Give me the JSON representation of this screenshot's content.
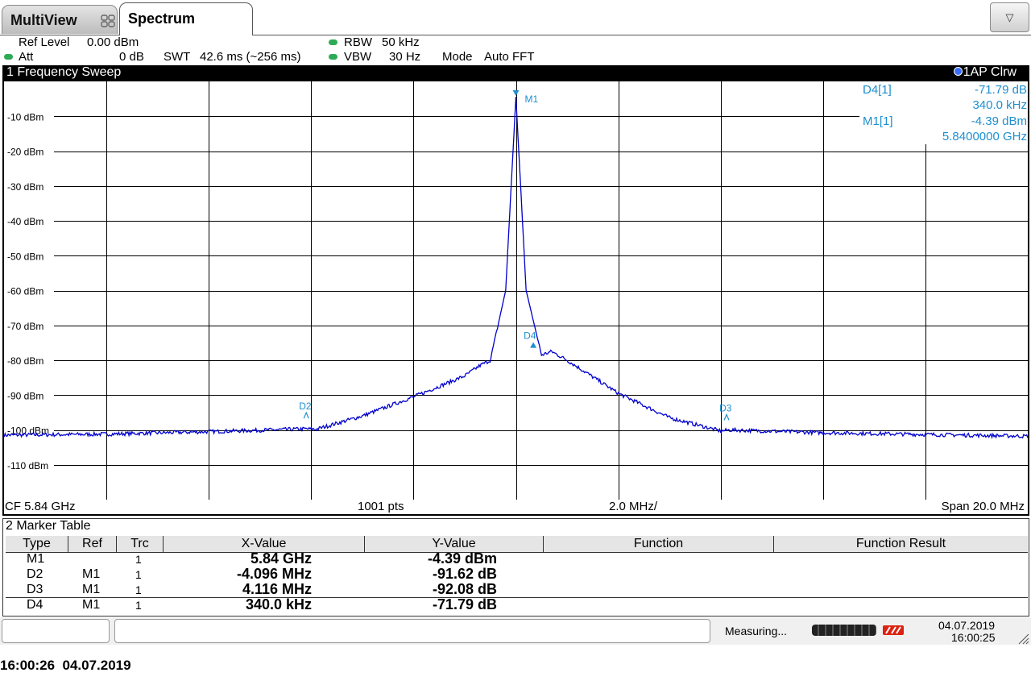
{
  "tabs": {
    "multiview": "MultiView",
    "spectrum": "Spectrum",
    "dropdown_icon": "▽"
  },
  "settings": {
    "ref_level_label": "Ref Level",
    "ref_level_value": "0.00 dBm",
    "att_label": "Att",
    "att_value": "0 dB",
    "swt_label": "SWT",
    "swt_value": "42.6 ms (~256 ms)",
    "rbw_label": "RBW",
    "rbw_value": "50 kHz",
    "vbw_label": "VBW",
    "vbw_value": "30 Hz",
    "mode_label": "Mode",
    "mode_value": "Auto FFT"
  },
  "diagram": {
    "title": "1 Frequency Sweep",
    "trace_label": "1AP Clrw",
    "y_ticks": [
      "-10 dBm",
      "-20 dBm",
      "-30 dBm",
      "-40 dBm",
      "-50 dBm",
      "-60 dBm",
      "-70 dBm",
      "-80 dBm",
      "-90 dBm",
      "-100 dBm",
      "-110 dBm"
    ],
    "marker_info": {
      "d4_label": "D4[1]",
      "d4_y": "-71.79 dB",
      "d4_x": "340.0 kHz",
      "m1_label": "M1[1]",
      "m1_y": "-4.39 dBm",
      "m1_x": "5.8400000 GHz"
    },
    "marker_tags": [
      "M1",
      "D2",
      "D3",
      "D4"
    ],
    "footer": {
      "cf": "CF 5.84 GHz",
      "pts": "1001 pts",
      "div": "2.0 MHz/",
      "span": "Span 20.0 MHz"
    },
    "colors": {
      "trace": "#0000cc",
      "marker": "#1e8fcf",
      "grid": "#000000"
    }
  },
  "marker_table": {
    "title": "2 Marker Table",
    "headers": [
      "Type",
      "Ref",
      "Trc",
      "X-Value",
      "Y-Value",
      "Function",
      "Function Result"
    ],
    "rows": [
      {
        "type": "M1",
        "ref": "",
        "trc": "1",
        "x": "5.84 GHz",
        "y": "-4.39 dBm"
      },
      {
        "type": "D2",
        "ref": "M1",
        "trc": "1",
        "x": "-4.096 MHz",
        "y": "-91.62 dB"
      },
      {
        "type": "D3",
        "ref": "M1",
        "trc": "1",
        "x": "4.116 MHz",
        "y": "-92.08 dB"
      },
      {
        "type": "D4",
        "ref": "M1",
        "trc": "1",
        "x": "340.0 kHz",
        "y": "-71.79 dB"
      }
    ]
  },
  "status": {
    "measuring": "Measuring...",
    "date": "04.07.2019",
    "time": "16:00:25",
    "bottom_timestamp": "16:00:26  04.07.2019"
  },
  "chart_data": {
    "type": "line",
    "title": "1 Frequency Sweep",
    "xlabel": "",
    "ylabel": "",
    "x_unit": "GHz",
    "ylim": [
      -120,
      0
    ],
    "xlim": [
      5.83,
      5.85
    ],
    "grid": true,
    "series": [
      {
        "name": "1AP Clrw",
        "x": [
          5.83,
          5.832,
          5.834,
          5.8359,
          5.8361,
          5.837,
          5.838,
          5.839,
          5.8393,
          5.8395,
          5.8398,
          5.84,
          5.8402,
          5.8405,
          5.8407,
          5.841,
          5.842,
          5.843,
          5.844,
          5.8442,
          5.846,
          5.848,
          5.85
        ],
        "values": [
          -101.5,
          -101.2,
          -100.5,
          -99.7,
          -99.8,
          -96,
          -90.5,
          -84.5,
          -81.5,
          -80,
          -60,
          -4.39,
          -60,
          -78.5,
          -77.5,
          -80,
          -89.5,
          -96.5,
          -100.3,
          -100.0,
          -100.8,
          -101.3,
          -101.8
        ]
      }
    ],
    "markers": [
      {
        "name": "M1",
        "x": 5.84,
        "y": -4.39
      },
      {
        "name": "D2",
        "x": 5.835904,
        "y": -96.0
      },
      {
        "name": "D3",
        "x": 5.844116,
        "y": -96.5
      },
      {
        "name": "D4",
        "x": 5.84034,
        "y": -76.2
      }
    ]
  }
}
